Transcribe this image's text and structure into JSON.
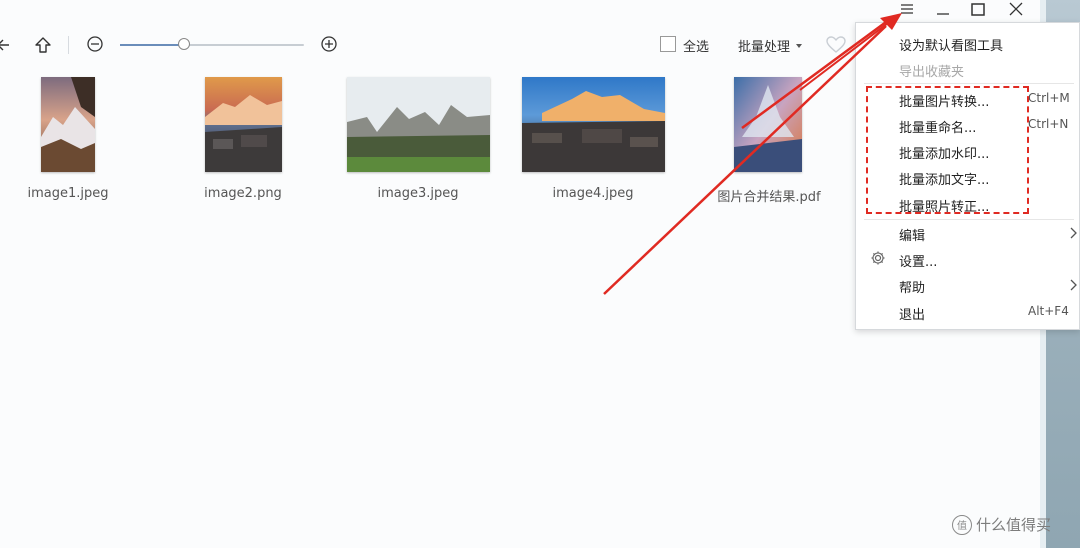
{
  "toolbar": {
    "select_all_label": "全选",
    "batch_label": "批量处理",
    "zoom_fraction": 0.35
  },
  "files": [
    {
      "name": "image1.jpeg"
    },
    {
      "name": "image2.png"
    },
    {
      "name": "image3.jpeg"
    },
    {
      "name": "image4.jpeg"
    },
    {
      "name": "图片合并结果.pdf"
    }
  ],
  "menu": {
    "items": [
      {
        "label": "设为默认看图工具",
        "shortcut": ""
      },
      {
        "label": "导出收藏夹",
        "shortcut": "",
        "disabled": true
      },
      {
        "label": "批量图片转换...",
        "shortcut": "Ctrl+M"
      },
      {
        "label": "批量重命名...",
        "shortcut": "Ctrl+N"
      },
      {
        "label": "批量添加水印...",
        "shortcut": ""
      },
      {
        "label": "批量添加文字...",
        "shortcut": ""
      },
      {
        "label": "批量照片转正...",
        "shortcut": ""
      },
      {
        "label": "编辑",
        "shortcut": ""
      },
      {
        "label": "设置...",
        "shortcut": ""
      },
      {
        "label": "帮助",
        "shortcut": ""
      },
      {
        "label": "退出",
        "shortcut": "Alt+F4"
      }
    ]
  },
  "watermark": {
    "text": "什么值得买",
    "badge": "值"
  },
  "colors": {
    "annotation_red": "#e02a22",
    "accent": "#6a8dba"
  }
}
